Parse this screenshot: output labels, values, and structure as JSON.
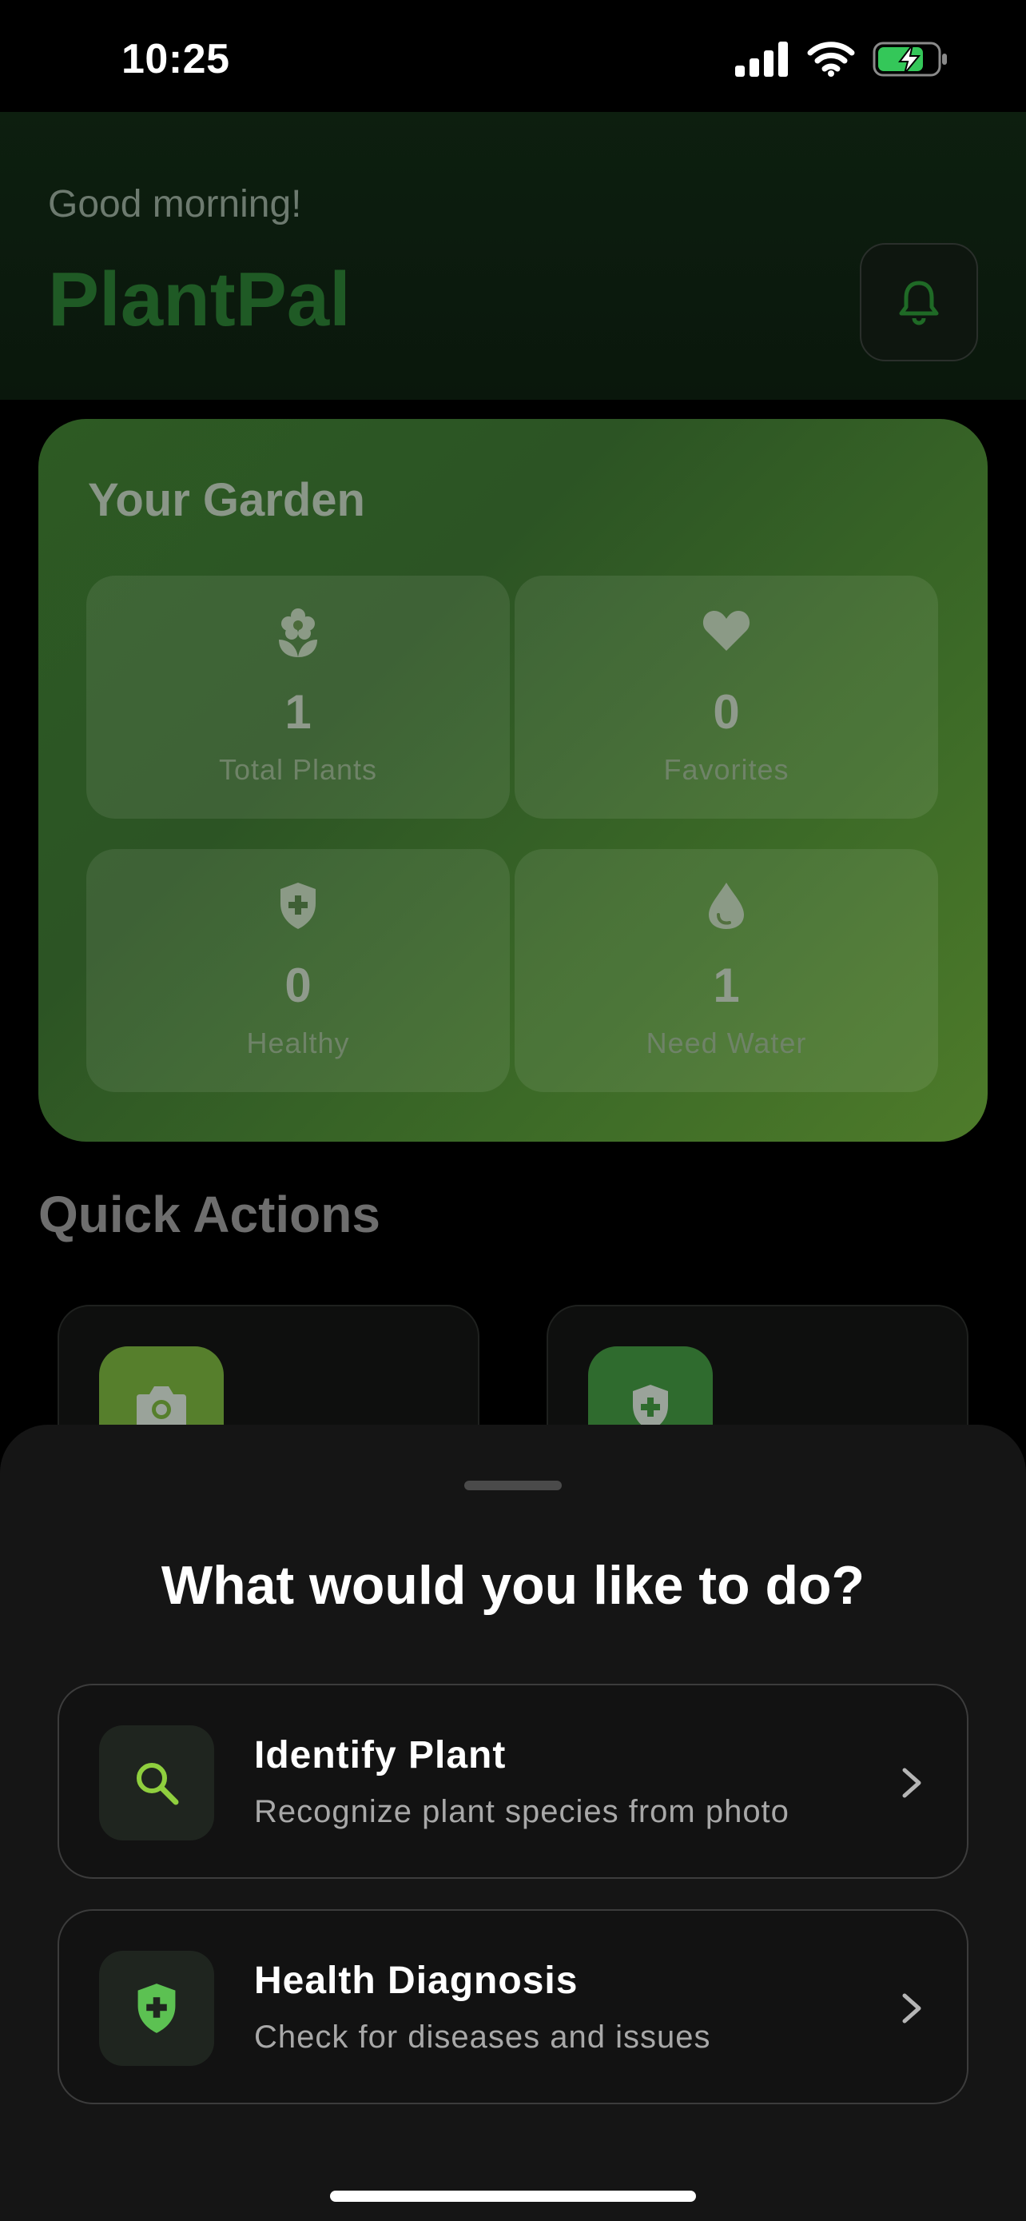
{
  "status_bar": {
    "time": "10:25"
  },
  "header": {
    "greeting": "Good morning!",
    "title": "PlantPal"
  },
  "garden": {
    "title": "Your Garden",
    "stats": [
      {
        "value": "1",
        "label": "Total Plants",
        "icon": "flower-icon"
      },
      {
        "value": "0",
        "label": "Favorites",
        "icon": "heart-icon"
      },
      {
        "value": "0",
        "label": "Healthy",
        "icon": "shield-plus-icon"
      },
      {
        "value": "1",
        "label": "Need Water",
        "icon": "water-drop-icon"
      }
    ]
  },
  "quick_actions": {
    "title": "Quick Actions"
  },
  "sheet": {
    "title": "What would you like to do?",
    "options": [
      {
        "title": "Identify Plant",
        "subtitle": "Recognize plant species from photo",
        "icon": "search-icon"
      },
      {
        "title": "Health Diagnosis",
        "subtitle": "Check for diseases and issues",
        "icon": "shield-plus-icon"
      }
    ]
  },
  "colors": {
    "accent_green": "#5cc152",
    "search_accent": "#8fcf3e",
    "sheet_bg": "#151515",
    "garden_card_start": "#2d5a23",
    "garden_card_end": "#4e7b2a"
  }
}
